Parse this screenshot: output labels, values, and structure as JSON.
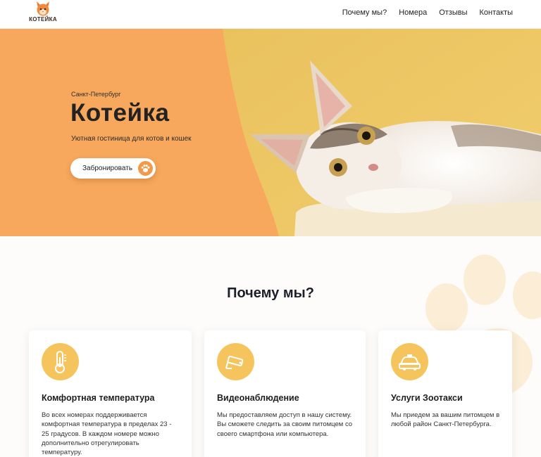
{
  "header": {
    "logo_text": "КОТЕЙКА",
    "nav": [
      "Почему мы?",
      "Номера",
      "Отзывы",
      "Контакты"
    ]
  },
  "hero": {
    "city": "Санкт-Петербург",
    "title": "Котейка",
    "subtitle": "Уютная гостиница для котов и кошек",
    "book_button": "Забронировать"
  },
  "why": {
    "title": "Почему мы?",
    "cards": [
      {
        "icon": "thermometer-icon",
        "title": "Комфортная температура",
        "text": "Во всех номерах поддерживается комфортная температура в пределах 23 - 25 градусов. В каждом номере можно дополнительно отрегулировать температуру."
      },
      {
        "icon": "camera-icon",
        "title": "Видеонаблюдение",
        "text": "Мы предоставляем доступ в нашу систему. Вы сможете следить за своим питомцем со своего смартфона или компьютера."
      },
      {
        "icon": "taxi-icon",
        "title": "Услуги Зоотакси",
        "text": "Мы приедем за вашим питомцем в любой район Санкт-Петербурга."
      }
    ]
  },
  "colors": {
    "hero_orange": "#f7a85c",
    "hero_yellow": "#f0c45e",
    "icon_circle": "#f6c45c",
    "paw_orange": "#f39a4a"
  }
}
